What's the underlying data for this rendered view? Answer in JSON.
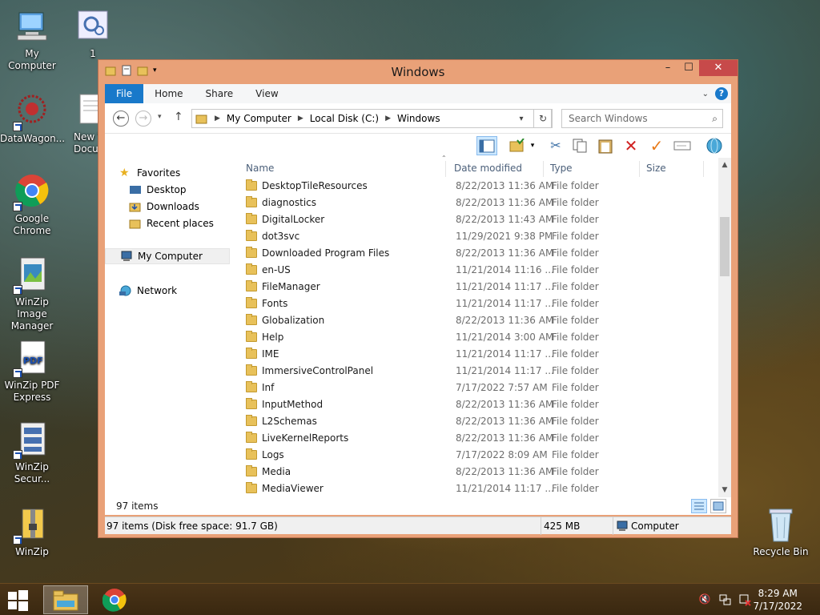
{
  "desktop": {
    "icons": [
      {
        "label": "My Computer"
      },
      {
        "label": "1"
      },
      {
        "label": "DataWagon..."
      },
      {
        "label": "New T\nDocu"
      },
      {
        "label": "Google Chrome"
      },
      {
        "label": "WinZip Image Manager"
      },
      {
        "label": "WinZip PDF Express"
      },
      {
        "label": "WinZip Secur..."
      },
      {
        "label": "WinZip"
      },
      {
        "label": "Recycle Bin"
      }
    ]
  },
  "window": {
    "title": "Windows",
    "controls": {
      "minimize": "–",
      "maximize": "☐",
      "close": "✕"
    },
    "ribbon_tabs": [
      "File",
      "Home",
      "Share",
      "View"
    ],
    "help": "?",
    "address": {
      "segments": [
        "My Computer",
        "Local Disk (C:)",
        "Windows"
      ]
    },
    "search": {
      "placeholder": "Search Windows"
    },
    "nav": {
      "favorites": "Favorites",
      "desktop": "Desktop",
      "downloads": "Downloads",
      "recent": "Recent places",
      "computer": "My Computer",
      "network": "Network"
    },
    "columns": {
      "name": "Name",
      "date": "Date modified",
      "type": "Type",
      "size": "Size"
    },
    "files": [
      {
        "name": "DesktopTileResources",
        "date": "8/22/2013 11:36 AM",
        "type": "File folder"
      },
      {
        "name": "diagnostics",
        "date": "8/22/2013 11:36 AM",
        "type": "File folder"
      },
      {
        "name": "DigitalLocker",
        "date": "8/22/2013 11:43 AM",
        "type": "File folder"
      },
      {
        "name": "dot3svc",
        "date": "11/29/2021 9:38 PM",
        "type": "File folder"
      },
      {
        "name": "Downloaded Program Files",
        "date": "8/22/2013 11:36 AM",
        "type": "File folder"
      },
      {
        "name": "en-US",
        "date": "11/21/2014 11:16 ...",
        "type": "File folder"
      },
      {
        "name": "FileManager",
        "date": "11/21/2014 11:17 ...",
        "type": "File folder"
      },
      {
        "name": "Fonts",
        "date": "11/21/2014 11:17 ...",
        "type": "File folder"
      },
      {
        "name": "Globalization",
        "date": "8/22/2013 11:36 AM",
        "type": "File folder"
      },
      {
        "name": "Help",
        "date": "11/21/2014 3:00 AM",
        "type": "File folder"
      },
      {
        "name": "IME",
        "date": "11/21/2014 11:17 ...",
        "type": "File folder"
      },
      {
        "name": "ImmersiveControlPanel",
        "date": "11/21/2014 11:17 ...",
        "type": "File folder"
      },
      {
        "name": "Inf",
        "date": "7/17/2022 7:57 AM",
        "type": "File folder"
      },
      {
        "name": "InputMethod",
        "date": "8/22/2013 11:36 AM",
        "type": "File folder"
      },
      {
        "name": "L2Schemas",
        "date": "8/22/2013 11:36 AM",
        "type": "File folder"
      },
      {
        "name": "LiveKernelReports",
        "date": "8/22/2013 11:36 AM",
        "type": "File folder"
      },
      {
        "name": "Logs",
        "date": "7/17/2022 8:09 AM",
        "type": "File folder"
      },
      {
        "name": "Media",
        "date": "8/22/2013 11:36 AM",
        "type": "File folder"
      },
      {
        "name": "MediaViewer",
        "date": "11/21/2014 11:17 ...",
        "type": "File folder"
      }
    ],
    "items_count": "97 items",
    "status": {
      "left": "97 items (Disk free space: 91.7 GB)",
      "size": "425 MB",
      "location": "Computer"
    }
  },
  "taskbar": {
    "time": "8:29 AM",
    "date": "7/17/2022"
  },
  "colors": {
    "file_tab": "#1979ca",
    "window_frame": "#e9a178",
    "close_button": "#c74a4a"
  }
}
